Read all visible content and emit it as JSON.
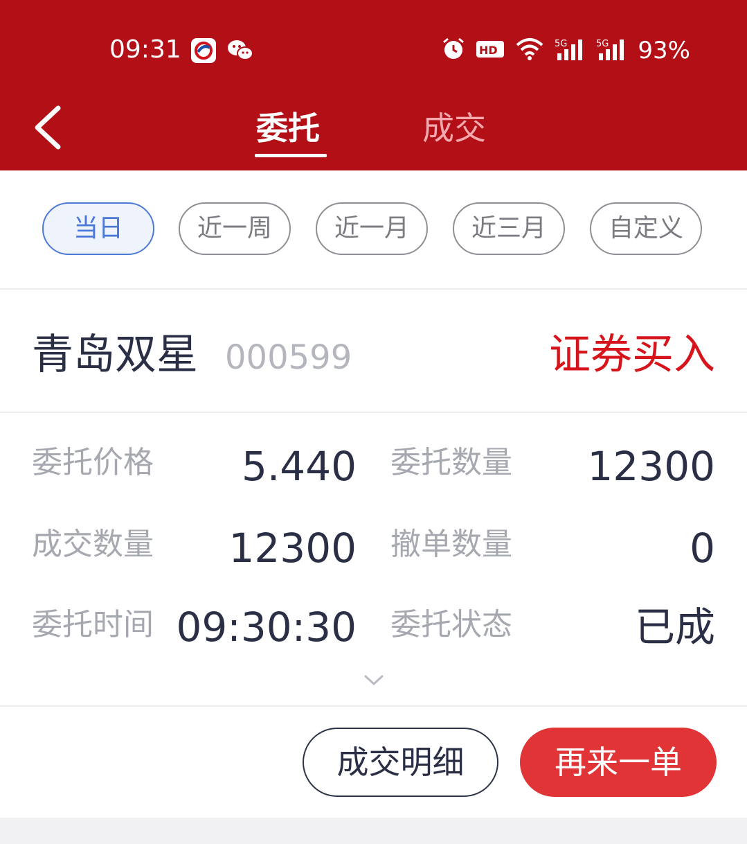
{
  "status_bar": {
    "time": "09:31",
    "battery": "93%",
    "icons": [
      "bank-app-icon",
      "wechat-icon",
      "alarm-icon",
      "hd-icon",
      "wifi-icon",
      "signal-5g-icon",
      "signal-5g-icon"
    ]
  },
  "header": {
    "tabs": [
      {
        "label": "委托",
        "active": true
      },
      {
        "label": "成交",
        "active": false
      }
    ]
  },
  "filters": [
    {
      "label": "当日",
      "active": true
    },
    {
      "label": "近一周",
      "active": false
    },
    {
      "label": "近一月",
      "active": false
    },
    {
      "label": "近三月",
      "active": false
    },
    {
      "label": "自定义",
      "active": false
    }
  ],
  "order": {
    "stock_name": "青岛双星",
    "stock_code": "000599",
    "action": "证券买入",
    "fields": [
      {
        "label": "委托价格",
        "value": "5.440"
      },
      {
        "label": "委托数量",
        "value": "12300"
      },
      {
        "label": "成交数量",
        "value": "12300"
      },
      {
        "label": "撤单数量",
        "value": "0"
      },
      {
        "label": "委托时间",
        "value": "09:30:30"
      },
      {
        "label": "委托状态",
        "value": "已成"
      }
    ]
  },
  "buttons": {
    "detail": "成交明细",
    "reorder": "再来一单"
  },
  "colors": {
    "header_bg": "#b30f17",
    "action_red": "#d6141b",
    "chip_active": "#4a77d8",
    "button_red": "#e13437"
  }
}
